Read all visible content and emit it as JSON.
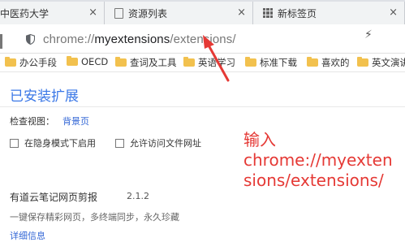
{
  "tabs": [
    {
      "label": "中医药大学",
      "close": "×"
    },
    {
      "label": "资源列表",
      "close": "×"
    },
    {
      "label": "新标签页",
      "close": "×"
    }
  ],
  "omnibox": {
    "scheme": "chrome://",
    "host": "myextensions",
    "path": "/extensions/"
  },
  "bookmarks": [
    "办公手段",
    "OECD",
    "查词及工具",
    "英语学习",
    "标准下载",
    "喜欢的",
    "英文演讲"
  ],
  "page": {
    "title": "已安装扩展",
    "inspect_label": "检查视图：",
    "inspect_link": "背景页",
    "checkbox_incognito": "在隐身模式下启用",
    "checkbox_file_urls": "允许访问文件网址",
    "extension": {
      "name": "有道云笔记网页剪报",
      "version": "2.1.2",
      "description": "一键保存精彩网页，多终端同步，永久珍藏",
      "details_link": "详细信息"
    }
  },
  "annotation": {
    "line1": "输入",
    "line2": "chrome://myexten",
    "line3": "sions/extensions/",
    "color": "#e53935"
  },
  "colors": {
    "accent": "#3b78e7",
    "link": "#3367d6",
    "folder": "#f2c14e"
  },
  "icons": {
    "tab2": "doc-icon",
    "tab3": "grid-icon",
    "omnibox": "shield-icon",
    "toolbar_right": "lightning-icon"
  }
}
